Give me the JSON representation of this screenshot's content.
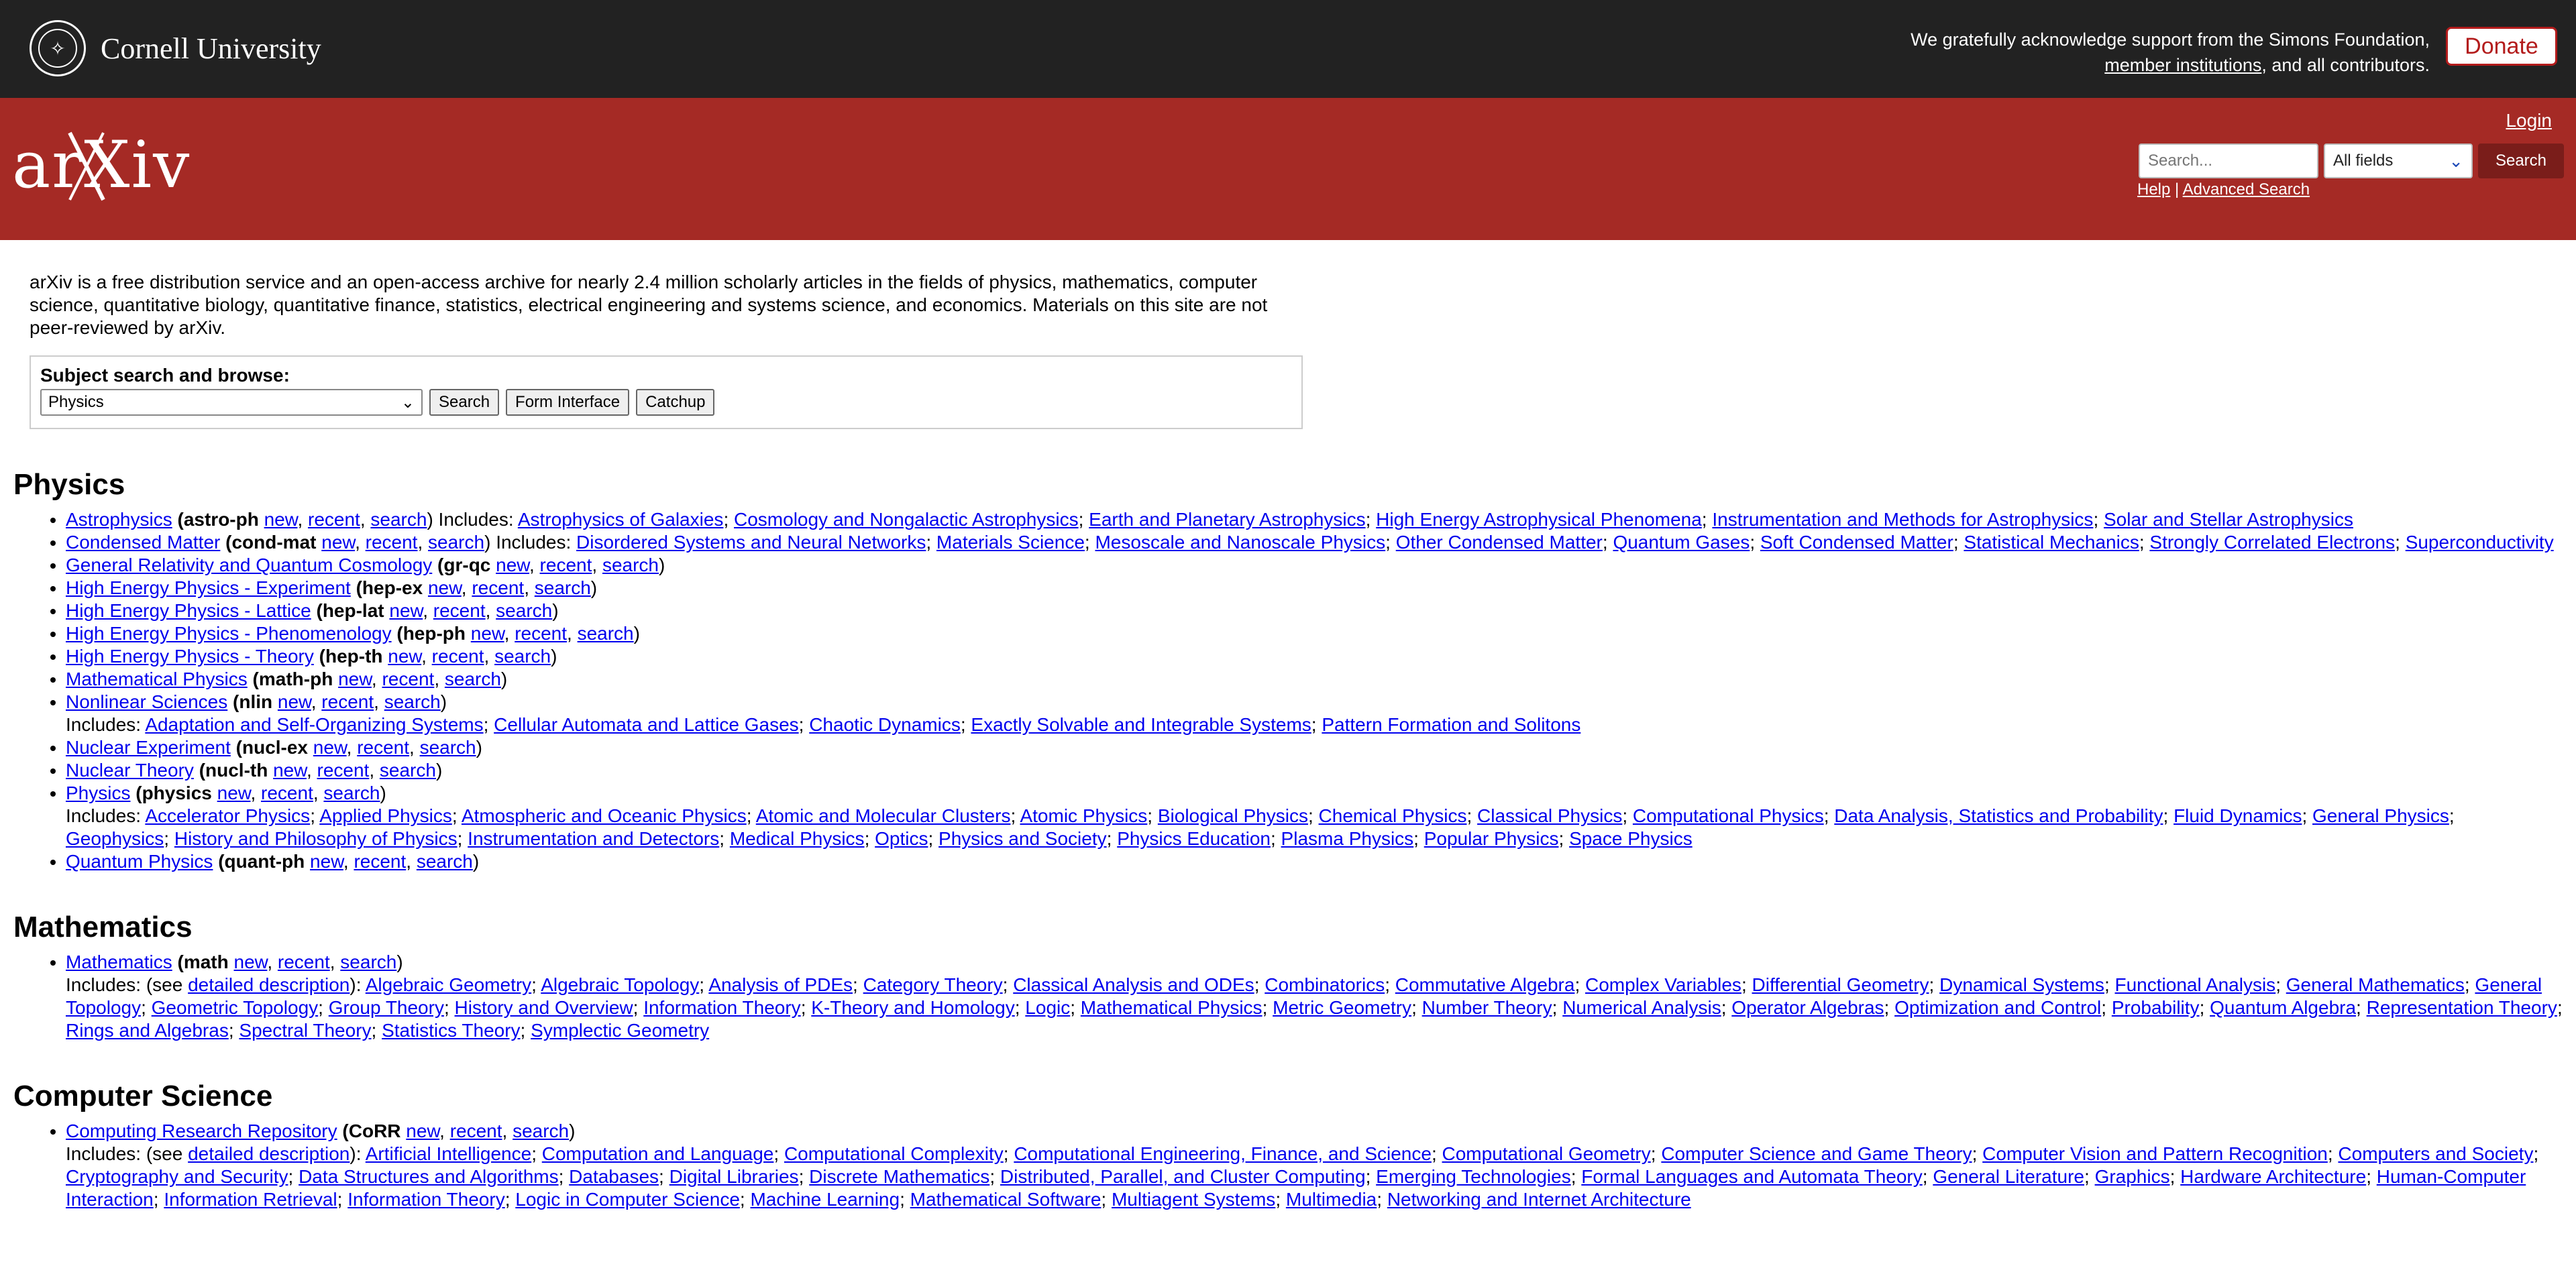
{
  "topbar": {
    "university": "Cornell University",
    "support_text": "We gratefully acknowledge support from the Simons Foundation,",
    "member_link": "member institutions",
    "support_tail": ", and all contributors.",
    "donate_label": "Donate"
  },
  "header": {
    "logo_text": "arXiv",
    "login_label": "Login",
    "search_placeholder": "Search...",
    "field_select_value": "All fields",
    "search_button": "Search",
    "help_label": "Help",
    "advanced_search_label": "Advanced Search",
    "separator": "|"
  },
  "intro": "arXiv is a free distribution service and an open-access archive for nearly 2.4 million scholarly articles in the fields of physics, mathematics, computer science, quantitative biology, quantitative finance, statistics, electrical engineering and systems science, and economics. Materials on this site are not peer-reviewed by arXiv.",
  "browse": {
    "label": "Subject search and browse:",
    "select_value": "Physics",
    "search_btn": "Search",
    "form_btn": "Form Interface",
    "catchup_btn": "Catchup"
  },
  "labels": {
    "new": "new",
    "recent": "recent",
    "search": "search",
    "includes": "Includes:",
    "see": "(see",
    "detailed": "detailed description",
    "close_paren": "):"
  },
  "physics": {
    "title": "Physics",
    "astro_name": "Astrophysics",
    "astro_abbr": "(astro-ph",
    "astro_subs": [
      "Astrophysics of Galaxies",
      "Cosmology and Nongalactic Astrophysics",
      "Earth and Planetary Astrophysics",
      "High Energy Astrophysical Phenomena",
      "Instrumentation and Methods for Astrophysics",
      "Solar and Stellar Astrophysics"
    ],
    "cond_name": "Condensed Matter",
    "cond_abbr": "(cond-mat",
    "cond_subs": [
      "Disordered Systems and Neural Networks",
      "Materials Science",
      "Mesoscale and Nanoscale Physics",
      "Other Condensed Matter",
      "Quantum Gases",
      "Soft Condensed Matter",
      "Statistical Mechanics",
      "Strongly Correlated Electrons",
      "Superconductivity"
    ],
    "grqc_name": "General Relativity and Quantum Cosmology",
    "grqc_abbr": "(gr-qc",
    "hepex_name": "High Energy Physics - Experiment",
    "hepex_abbr": "(hep-ex",
    "heplat_name": "High Energy Physics - Lattice",
    "heplat_abbr": "(hep-lat",
    "hepph_name": "High Energy Physics - Phenomenology",
    "hepph_abbr": "(hep-ph",
    "hepth_name": "High Energy Physics - Theory",
    "hepth_abbr": "(hep-th",
    "mathph_name": "Mathematical Physics",
    "mathph_abbr": "(math-ph",
    "nlin_name": "Nonlinear Sciences",
    "nlin_abbr": "(nlin",
    "nlin_subs": [
      "Adaptation and Self-Organizing Systems",
      "Cellular Automata and Lattice Gases",
      "Chaotic Dynamics",
      "Exactly Solvable and Integrable Systems",
      "Pattern Formation and Solitons"
    ],
    "nuclex_name": "Nuclear Experiment",
    "nuclex_abbr": "(nucl-ex",
    "nuclth_name": "Nuclear Theory",
    "nuclth_abbr": "(nucl-th",
    "phys_name": "Physics",
    "phys_abbr": "(physics",
    "phys_subs": [
      "Accelerator Physics",
      "Applied Physics",
      "Atmospheric and Oceanic Physics",
      "Atomic and Molecular Clusters",
      "Atomic Physics",
      "Biological Physics",
      "Chemical Physics",
      "Classical Physics",
      "Computational Physics",
      "Data Analysis, Statistics and Probability",
      "Fluid Dynamics",
      "General Physics",
      "Geophysics",
      "History and Philosophy of Physics",
      "Instrumentation and Detectors",
      "Medical Physics",
      "Optics",
      "Physics and Society",
      "Physics Education",
      "Plasma Physics",
      "Popular Physics",
      "Space Physics"
    ],
    "quant_name": "Quantum Physics",
    "quant_abbr": "(quant-ph"
  },
  "math": {
    "title": "Mathematics",
    "name": "Mathematics",
    "abbr": "(math",
    "subs": [
      "Algebraic Geometry",
      "Algebraic Topology",
      "Analysis of PDEs",
      "Category Theory",
      "Classical Analysis and ODEs",
      "Combinatorics",
      "Commutative Algebra",
      "Complex Variables",
      "Differential Geometry",
      "Dynamical Systems",
      "Functional Analysis",
      "General Mathematics",
      "General Topology",
      "Geometric Topology",
      "Group Theory",
      "History and Overview",
      "Information Theory",
      "K-Theory and Homology",
      "Logic",
      "Mathematical Physics",
      "Metric Geometry",
      "Number Theory",
      "Numerical Analysis",
      "Operator Algebras",
      "Optimization and Control",
      "Probability",
      "Quantum Algebra",
      "Representation Theory",
      "Rings and Algebras",
      "Spectral Theory",
      "Statistics Theory",
      "Symplectic Geometry"
    ]
  },
  "cs": {
    "title": "Computer Science",
    "name": "Computing Research Repository",
    "abbr": "(CoRR",
    "subs": [
      "Artificial Intelligence",
      "Computation and Language",
      "Computational Complexity",
      "Computational Engineering, Finance, and Science",
      "Computational Geometry",
      "Computer Science and Game Theory",
      "Computer Vision and Pattern Recognition",
      "Computers and Society",
      "Cryptography and Security",
      "Data Structures and Algorithms",
      "Databases",
      "Digital Libraries",
      "Discrete Mathematics",
      "Distributed, Parallel, and Cluster Computing",
      "Emerging Technologies",
      "Formal Languages and Automata Theory",
      "General Literature",
      "Graphics",
      "Hardware Architecture",
      "Human-Computer Interaction",
      "Information Retrieval",
      "Information Theory",
      "Logic in Computer Science",
      "Machine Learning",
      "Mathematical Software",
      "Multiagent Systems",
      "Multimedia",
      "Networking and Internet Architecture"
    ]
  }
}
